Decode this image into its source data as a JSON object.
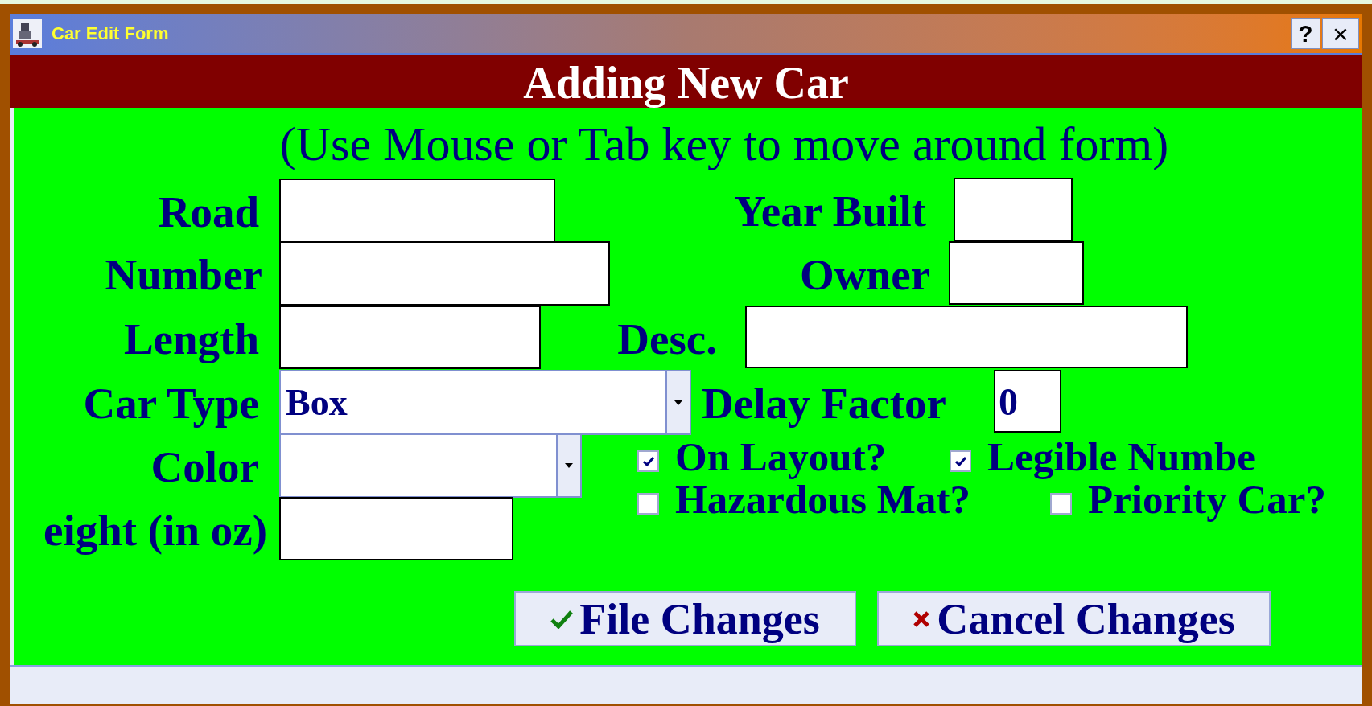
{
  "window": {
    "title": "Car Edit Form",
    "help_button": "?",
    "close_button": "×"
  },
  "header": "Adding New Car",
  "instructions": "(Use Mouse or Tab key to move around form)",
  "fields": [
    {
      "kind": "text",
      "label": "Road"
    },
    {
      "kind": "text",
      "label": "Number"
    },
    {
      "kind": "text",
      "label": "Length"
    },
    {
      "kind": "dropdown",
      "label": "Car Type",
      "value": "Box"
    },
    {
      "kind": "dropdown",
      "label": "Color"
    },
    {
      "kind": "text",
      "label": "eight (in oz)"
    },
    {
      "kind": "text",
      "label": "Year Built"
    },
    {
      "kind": "text",
      "label": "Owner"
    },
    {
      "kind": "text",
      "label": "Desc."
    },
    {
      "kind": "text",
      "label": "Delay Factor",
      "value": "0"
    }
  ],
  "checkboxes": [
    {
      "label": "On Layout?",
      "checked": true
    },
    {
      "label": "Legible Numbe",
      "checked": true
    },
    {
      "label": "Hazardous Mat?",
      "checked": false
    },
    {
      "label": "Priority Car?",
      "checked": false
    }
  ],
  "buttons": [
    {
      "kind": "confirm",
      "label": "File Changes"
    },
    {
      "kind": "cancel",
      "label": "Cancel Changes"
    }
  ]
}
